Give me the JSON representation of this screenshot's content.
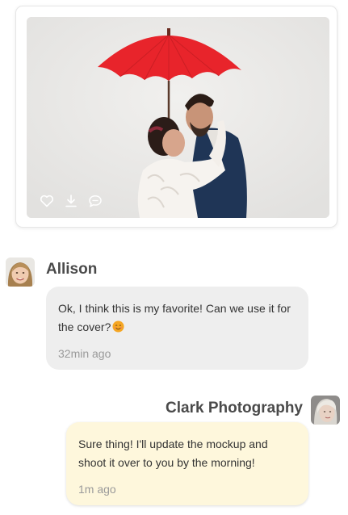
{
  "post": {
    "actions": [
      {
        "icon": "heart-icon"
      },
      {
        "icon": "download-icon"
      },
      {
        "icon": "comment-icon"
      }
    ]
  },
  "messages": [
    {
      "author": "Allison",
      "text": "Ok, I think this is my favorite! Can we use it for the cover?",
      "emoji": "smiling-face-emoji",
      "time": "32min ago",
      "bubble_color": "#eeeeee"
    },
    {
      "author": "Clark Photography",
      "text": "Sure thing! I'll update the mockup and shoot it over to you by the morning!",
      "time": "1m ago",
      "bubble_color": "#fef7dc"
    }
  ],
  "colors": {
    "name_text": "#4a4a4a",
    "time_text": "#9a9a9a",
    "umbrella": "#e8242b"
  }
}
